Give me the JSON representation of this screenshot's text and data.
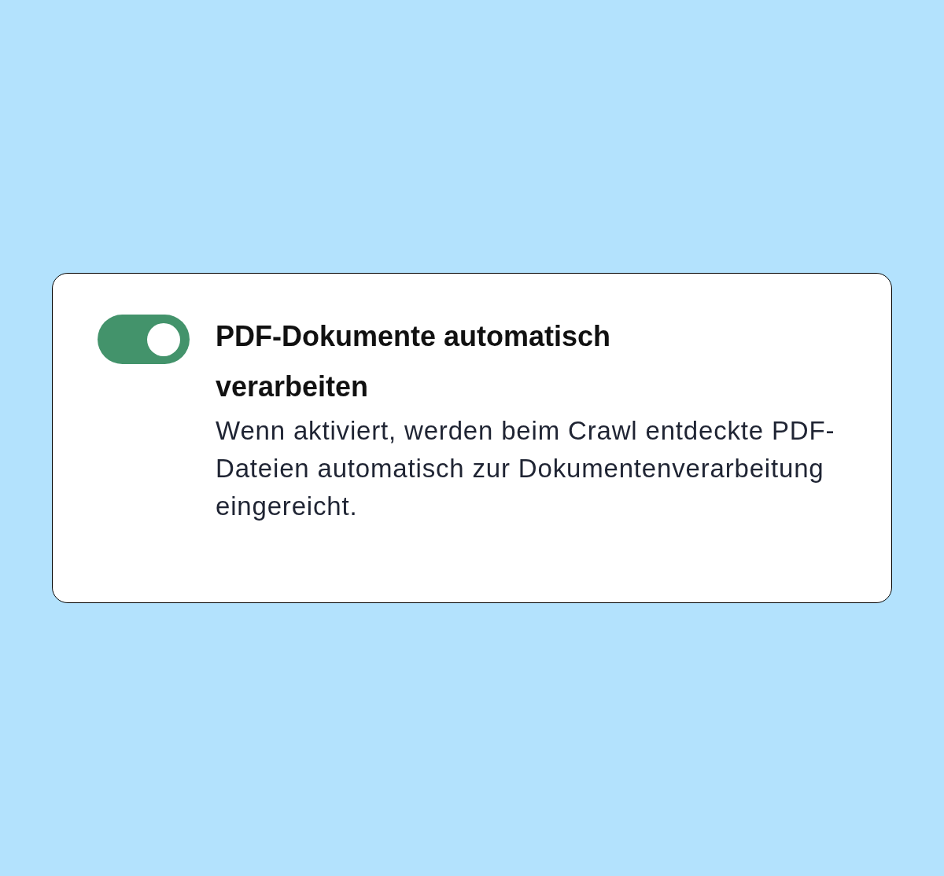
{
  "setting": {
    "on": true,
    "title": "PDF-Dokumente automatisch verarbeiten",
    "description": "Wenn aktiviert, werden beim Crawl entdeckte PDF-Dateien automatisch zur Dokumentenverarbeitung eingereicht."
  }
}
